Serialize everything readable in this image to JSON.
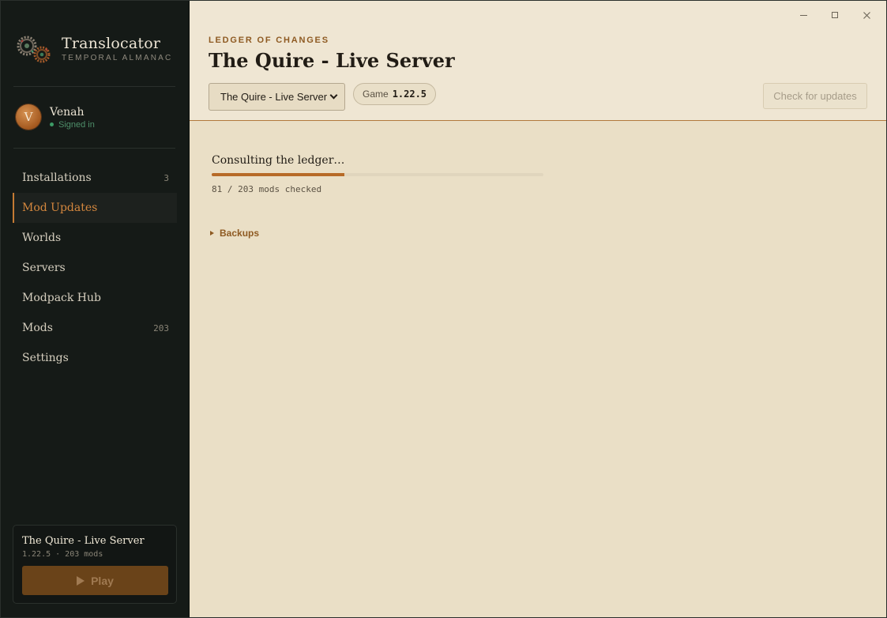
{
  "app": {
    "title": "Translocator",
    "subtitle": "TEMPORAL ALMANAC"
  },
  "user": {
    "initial": "V",
    "name": "Venah",
    "status": "Signed in"
  },
  "sidebar": {
    "items": [
      {
        "label": "Installations",
        "count": "3",
        "active": false
      },
      {
        "label": "Mod Updates",
        "count": "",
        "active": true
      },
      {
        "label": "Worlds",
        "count": "",
        "active": false
      },
      {
        "label": "Servers",
        "count": "",
        "active": false
      },
      {
        "label": "Modpack Hub",
        "count": "",
        "active": false
      },
      {
        "label": "Mods",
        "count": "203",
        "active": false
      },
      {
        "label": "Settings",
        "count": "",
        "active": false
      }
    ]
  },
  "play_card": {
    "title": "The Quire - Live Server",
    "meta": "1.22.5 · 203 mods",
    "play_label": "Play"
  },
  "header": {
    "eyebrow": "LEDGER OF CHANGES",
    "title": "The Quire - Live Server",
    "install_select": "The Quire - Live Server",
    "game_label": "Game",
    "game_version": "1.22.5",
    "check_label": "Check for updates"
  },
  "progress": {
    "title": "Consulting the ledger…",
    "text": "81 / 203 mods checked",
    "checked": 81,
    "total": 203
  },
  "backups": {
    "label": "Backups"
  },
  "colors": {
    "accent": "#c57a34",
    "sidebar_bg": "#151a17",
    "main_bg": "#eadfc6",
    "status_green": "#3d9b66"
  }
}
